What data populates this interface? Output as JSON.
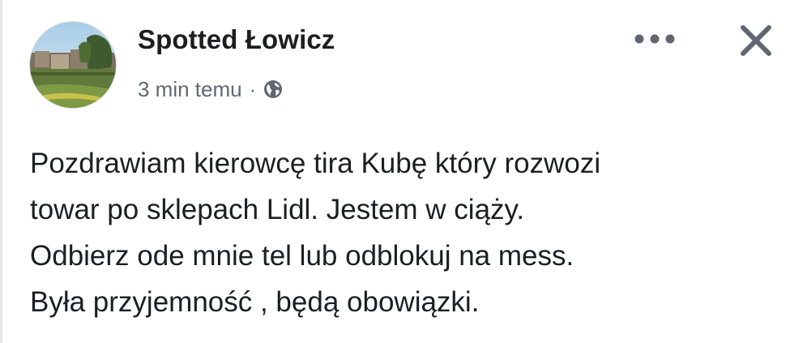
{
  "post": {
    "page_name": "Spotted Łowicz",
    "timestamp": "3 min temu",
    "separator": "·",
    "audience_icon": "globe-icon",
    "more_icon": "more-options-icon",
    "close_icon": "close-icon",
    "text_lines": [
      "Pozdrawiam kierowcę tira Kubę który rozwozi",
      "towar po sklepach Lidl. Jestem w ciąży.",
      "Odbierz ode mnie tel lub odblokuj na mess.",
      "Była przyjemność , będą obowiązki."
    ]
  },
  "colors": {
    "text_primary": "#1c1e21",
    "text_secondary": "#606770",
    "icon": "#606770"
  }
}
